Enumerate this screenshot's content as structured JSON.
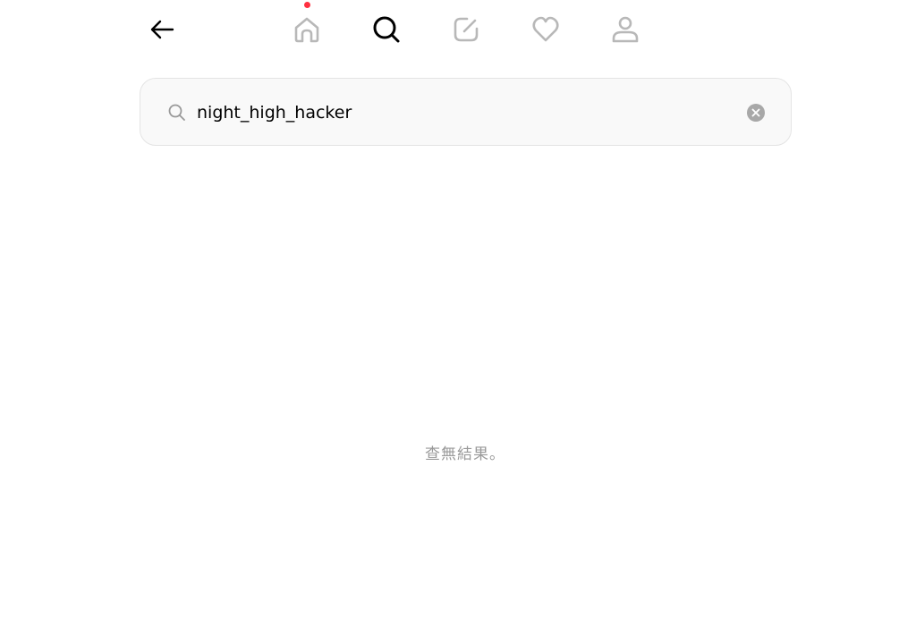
{
  "nav": {
    "back_icon": "arrow-left-icon",
    "items": [
      {
        "name": "home",
        "icon": "home-icon",
        "active": false,
        "has_notification": true
      },
      {
        "name": "search",
        "icon": "search-icon",
        "active": true
      },
      {
        "name": "create",
        "icon": "edit-icon",
        "active": false
      },
      {
        "name": "activity",
        "icon": "heart-icon",
        "active": false
      },
      {
        "name": "profile",
        "icon": "person-icon",
        "active": false
      }
    ],
    "notification_color": "#ff3040"
  },
  "search": {
    "value": "night_high_hacker",
    "icon": "search-icon",
    "clear_icon": "clear-circle-icon"
  },
  "results": {
    "empty_text": "查無結果。"
  },
  "colors": {
    "active_icon": "#000000",
    "inactive_icon": "#b8b8b8",
    "muted_text": "#999999",
    "search_background": "#f9f9f9"
  }
}
